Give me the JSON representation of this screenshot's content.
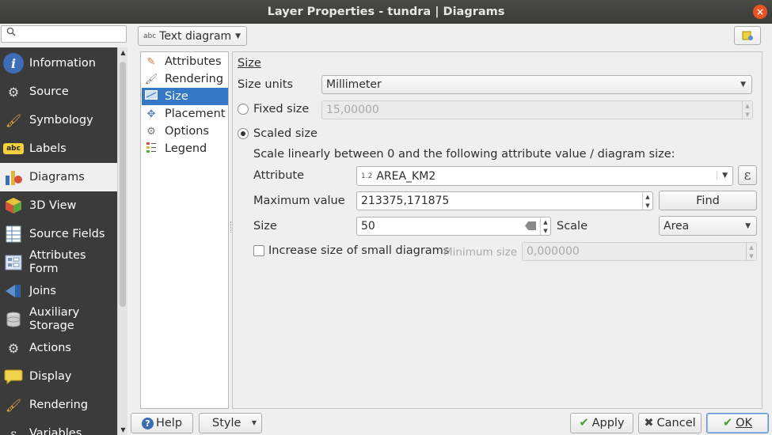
{
  "window": {
    "title": "Layer Properties - tundra | Diagrams",
    "close_glyph": "×"
  },
  "search": {
    "placeholder": "",
    "value": ""
  },
  "sidebar": {
    "items": [
      {
        "label": "Information",
        "icon": "info-icon"
      },
      {
        "label": "Source",
        "icon": "source-icon"
      },
      {
        "label": "Symbology",
        "icon": "symbology-icon"
      },
      {
        "label": "Labels",
        "icon": "labels-icon"
      },
      {
        "label": "Diagrams",
        "icon": "diagrams-icon",
        "active": true
      },
      {
        "label": "3D View",
        "icon": "cube-icon"
      },
      {
        "label": "Source Fields",
        "icon": "fields-icon"
      },
      {
        "label": "Attributes Form",
        "icon": "form-icon"
      },
      {
        "label": "Joins",
        "icon": "joins-icon"
      },
      {
        "label": "Auxiliary Storage",
        "icon": "storage-icon"
      },
      {
        "label": "Actions",
        "icon": "actions-icon"
      },
      {
        "label": "Display",
        "icon": "display-icon"
      },
      {
        "label": "Rendering",
        "icon": "rendering-icon"
      },
      {
        "label": "Variables",
        "icon": "variables-icon"
      }
    ]
  },
  "toolbar": {
    "diagram_type_prefix": "abc",
    "diagram_type": "Text diagram"
  },
  "subtree": {
    "items": [
      {
        "label": "Attributes",
        "icon": "attributes-icon"
      },
      {
        "label": "Rendering",
        "icon": "brush-icon"
      },
      {
        "label": "Size",
        "icon": "size-icon",
        "active": true
      },
      {
        "label": "Placement",
        "icon": "placement-icon"
      },
      {
        "label": "Options",
        "icon": "options-icon"
      },
      {
        "label": "Legend",
        "icon": "legend-icon"
      }
    ]
  },
  "size_panel": {
    "section_title": "Size",
    "size_units_label": "Size units",
    "size_units_value": "Millimeter",
    "fixed_size_label": "Fixed size",
    "fixed_size_value": "15,00000",
    "fixed_size_selected": false,
    "scaled_size_label": "Scaled size",
    "scaled_size_selected": true,
    "scale_description": "Scale linearly between 0 and the following attribute value / diagram size:",
    "attribute_label": "Attribute",
    "attribute_type_prefix": "1.2",
    "attribute_value": "AREA_KM2",
    "expression_glyph": "ε",
    "max_value_label": "Maximum value",
    "max_value": "213375,171875",
    "find_label": "Find",
    "size_label": "Size",
    "size_value": "50",
    "scale_label": "Scale",
    "scale_value": "Area",
    "increase_small_label": "Increase size of small diagrams",
    "increase_small_checked": false,
    "min_size_label": "Minimum size",
    "min_size_value": "0,000000"
  },
  "buttons": {
    "help": "Help",
    "style": "Style",
    "apply": "Apply",
    "cancel": "Cancel",
    "ok": "OK"
  },
  "colors": {
    "selection": "#3478c6",
    "sidebar_bg": "#3b3b3b",
    "close": "#e95420"
  }
}
